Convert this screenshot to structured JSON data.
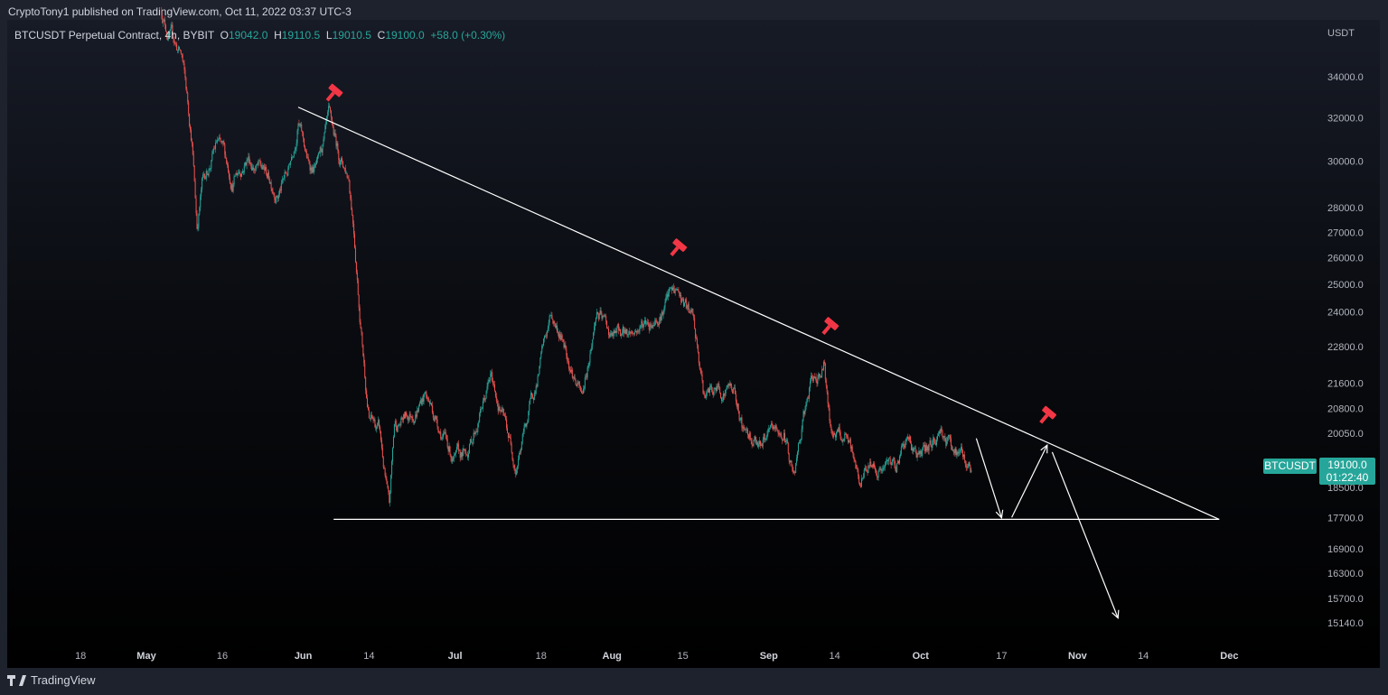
{
  "publisher": "CryptoTony1 published on TradingView.com, Oct 11, 2022 03:37 UTC-3",
  "legend": {
    "symbol": "BTCUSDT Perpetual Contract, 4h, BYBIT",
    "o_label": "O",
    "o": "19042.0",
    "h_label": "H",
    "h": "19110.5",
    "l_label": "L",
    "l": "19010.5",
    "c_label": "C",
    "c": "19100.0",
    "change": "+58.0 (+0.30%)"
  },
  "footer": {
    "brand": "TradingView"
  },
  "badges": {
    "symbol": "BTCUSDT",
    "price": "19100.0",
    "countdown": "01:22:40"
  },
  "colors": {
    "up": "#26a69a",
    "down": "#ef5350",
    "drawing": "#ffffff",
    "marker": "#f23645",
    "axis_text": "#b2b5be"
  },
  "chart_data": {
    "type": "candlestick",
    "interval": "4h",
    "scale": "log",
    "grid": false,
    "ylabel": "USDT",
    "ylim": [
      14800,
      38000
    ],
    "xlim": [
      "2022-04-06",
      "2022-12-20"
    ],
    "y_ticks": [
      "34000.0",
      "32000.0",
      "30000.0",
      "28000.0",
      "27000.0",
      "26000.0",
      "25000.0",
      "24000.0",
      "22800.0",
      "21600.0",
      "20800.0",
      "20050.0",
      "18500.0",
      "17700.0",
      "16900.0",
      "16300.0",
      "15700.0",
      "15140.0"
    ],
    "x_ticks": [
      {
        "date": "2022-04-18",
        "label": "18",
        "major": false
      },
      {
        "date": "2022-05-01",
        "label": "May",
        "major": true
      },
      {
        "date": "2022-05-16",
        "label": "16",
        "major": false
      },
      {
        "date": "2022-06-01",
        "label": "Jun",
        "major": true
      },
      {
        "date": "2022-06-14",
        "label": "14",
        "major": false
      },
      {
        "date": "2022-07-01",
        "label": "Jul",
        "major": true
      },
      {
        "date": "2022-07-18",
        "label": "18",
        "major": false
      },
      {
        "date": "2022-08-01",
        "label": "Aug",
        "major": true
      },
      {
        "date": "2022-08-15",
        "label": "15",
        "major": false
      },
      {
        "date": "2022-09-01",
        "label": "Sep",
        "major": true
      },
      {
        "date": "2022-09-14",
        "label": "14",
        "major": false
      },
      {
        "date": "2022-10-01",
        "label": "Oct",
        "major": true
      },
      {
        "date": "2022-10-17",
        "label": "17",
        "major": false
      },
      {
        "date": "2022-11-01",
        "label": "Nov",
        "major": true
      },
      {
        "date": "2022-11-14",
        "label": "14",
        "major": false
      },
      {
        "date": "2022-12-01",
        "label": "Dec",
        "major": true
      }
    ],
    "price_path": [
      [
        "2022-05-04",
        37500
      ],
      [
        "2022-05-05",
        36600
      ],
      [
        "2022-05-08",
        35000
      ],
      [
        "2022-05-10",
        31000
      ],
      [
        "2022-05-11",
        27300
      ],
      [
        "2022-05-12",
        29000
      ],
      [
        "2022-05-15",
        30800
      ],
      [
        "2022-05-18",
        29200
      ],
      [
        "2022-05-21",
        30300
      ],
      [
        "2022-05-24",
        29500
      ],
      [
        "2022-05-27",
        28800
      ],
      [
        "2022-05-29",
        29500
      ],
      [
        "2022-05-31",
        32000
      ],
      [
        "2022-06-02",
        29800
      ],
      [
        "2022-06-04",
        29700
      ],
      [
        "2022-06-06",
        31500
      ],
      [
        "2022-06-08",
        30200
      ],
      [
        "2022-06-10",
        29400
      ],
      [
        "2022-06-11",
        27400
      ],
      [
        "2022-06-12",
        24600
      ],
      [
        "2022-06-13",
        22400
      ],
      [
        "2022-06-14",
        20600
      ],
      [
        "2022-06-16",
        20100
      ],
      [
        "2022-06-18",
        17800
      ],
      [
        "2022-06-19",
        20200
      ],
      [
        "2022-06-22",
        20600
      ],
      [
        "2022-06-25",
        21300
      ],
      [
        "2022-06-28",
        20300
      ],
      [
        "2022-07-01",
        19200
      ],
      [
        "2022-07-03",
        19300
      ],
      [
        "2022-07-08",
        21700
      ],
      [
        "2022-07-10",
        20800
      ],
      [
        "2022-07-13",
        19200
      ],
      [
        "2022-07-16",
        20900
      ],
      [
        "2022-07-20",
        23800
      ],
      [
        "2022-07-23",
        22800
      ],
      [
        "2022-07-26",
        21100
      ],
      [
        "2022-07-29",
        24000
      ],
      [
        "2022-08-01",
        23100
      ],
      [
        "2022-08-05",
        23300
      ],
      [
        "2022-08-09",
        23800
      ],
      [
        "2022-08-12",
        24500
      ],
      [
        "2022-08-14",
        24700
      ],
      [
        "2022-08-17",
        23600
      ],
      [
        "2022-08-19",
        21200
      ],
      [
        "2022-08-22",
        21400
      ],
      [
        "2022-08-25",
        21500
      ],
      [
        "2022-08-27",
        20100
      ],
      [
        "2022-09-01",
        19900
      ],
      [
        "2022-09-04",
        20000
      ],
      [
        "2022-09-06",
        18800
      ],
      [
        "2022-09-09",
        21300
      ],
      [
        "2022-09-12",
        22300
      ],
      [
        "2022-09-13",
        20300
      ],
      [
        "2022-09-16",
        19800
      ],
      [
        "2022-09-19",
        18700
      ],
      [
        "2022-09-21",
        19200
      ],
      [
        "2022-09-24",
        19000
      ],
      [
        "2022-09-26",
        19100
      ],
      [
        "2022-09-28",
        20000
      ],
      [
        "2022-10-01",
        19400
      ],
      [
        "2022-10-03",
        19600
      ],
      [
        "2022-10-05",
        20200
      ],
      [
        "2022-10-08",
        19500
      ],
      [
        "2022-10-11",
        19100
      ]
    ],
    "drawings": {
      "trendline": [
        [
          "2022-05-31",
          32500
        ],
        [
          "2022-11-29",
          17650
        ]
      ],
      "support_line": [
        [
          "2022-06-07",
          17650
        ],
        [
          "2022-11-29",
          17650
        ]
      ],
      "arrows": [
        [
          [
            "2022-10-12",
            19900
          ],
          [
            "2022-10-17",
            17690
          ]
        ],
        [
          [
            "2022-10-19",
            17700
          ],
          [
            "2022-10-26",
            19700
          ]
        ],
        [
          [
            "2022-10-27",
            19500
          ],
          [
            "2022-11-09",
            15250
          ]
        ]
      ],
      "markers": [
        [
          "2022-06-07",
          33200
        ],
        [
          "2022-08-14",
          26400
        ],
        [
          "2022-09-13",
          23500
        ],
        [
          "2022-10-26",
          20600
        ]
      ]
    }
  }
}
